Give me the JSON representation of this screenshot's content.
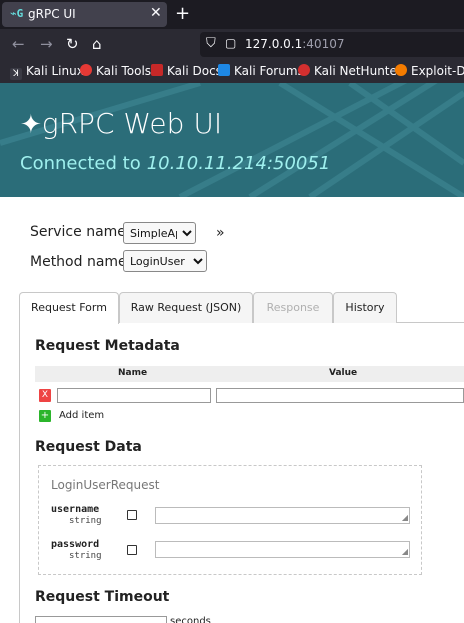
{
  "browser": {
    "tab_title": "gRPC UI",
    "tab_close": "✕",
    "new_tab": "+",
    "url_host": "127.0.0.1",
    "url_port": ":40107",
    "bookmarks": [
      {
        "label": "Kali Linux",
        "color": "#ffffff"
      },
      {
        "label": "Kali Tools",
        "color": "#e53935"
      },
      {
        "label": "Kali Docs",
        "color": "#c62828"
      },
      {
        "label": "Kali Forums",
        "color": "#1e88e5"
      },
      {
        "label": "Kali NetHunter",
        "color": "#d32f2f"
      },
      {
        "label": "Exploit-DB",
        "color": "#f57c00"
      }
    ]
  },
  "header": {
    "brand": "gRPC Web UI",
    "connected_label": "Connected to",
    "address": "10.10.11.214:50051",
    "bg_color": "#2b6d79"
  },
  "form": {
    "service_label": "Service name:",
    "service_value": "SimpleApp",
    "method_label": "Method name:",
    "method_value": "LoginUser",
    "expand": "»"
  },
  "tabs": [
    {
      "label": "Request Form",
      "state": "active"
    },
    {
      "label": "Raw Request (JSON)",
      "state": "normal"
    },
    {
      "label": "Response",
      "state": "disabled"
    },
    {
      "label": "History",
      "state": "normal"
    }
  ],
  "metadata": {
    "heading": "Request Metadata",
    "col_name": "Name",
    "col_value": "Value",
    "remove": "X",
    "add": "+",
    "add_label": "Add item"
  },
  "request_data": {
    "heading": "Request Data",
    "message": "LoginUserRequest",
    "fields": [
      {
        "name": "username",
        "type": "string"
      },
      {
        "name": "password",
        "type": "string"
      }
    ]
  },
  "timeout": {
    "heading": "Request Timeout",
    "unit": "seconds"
  }
}
